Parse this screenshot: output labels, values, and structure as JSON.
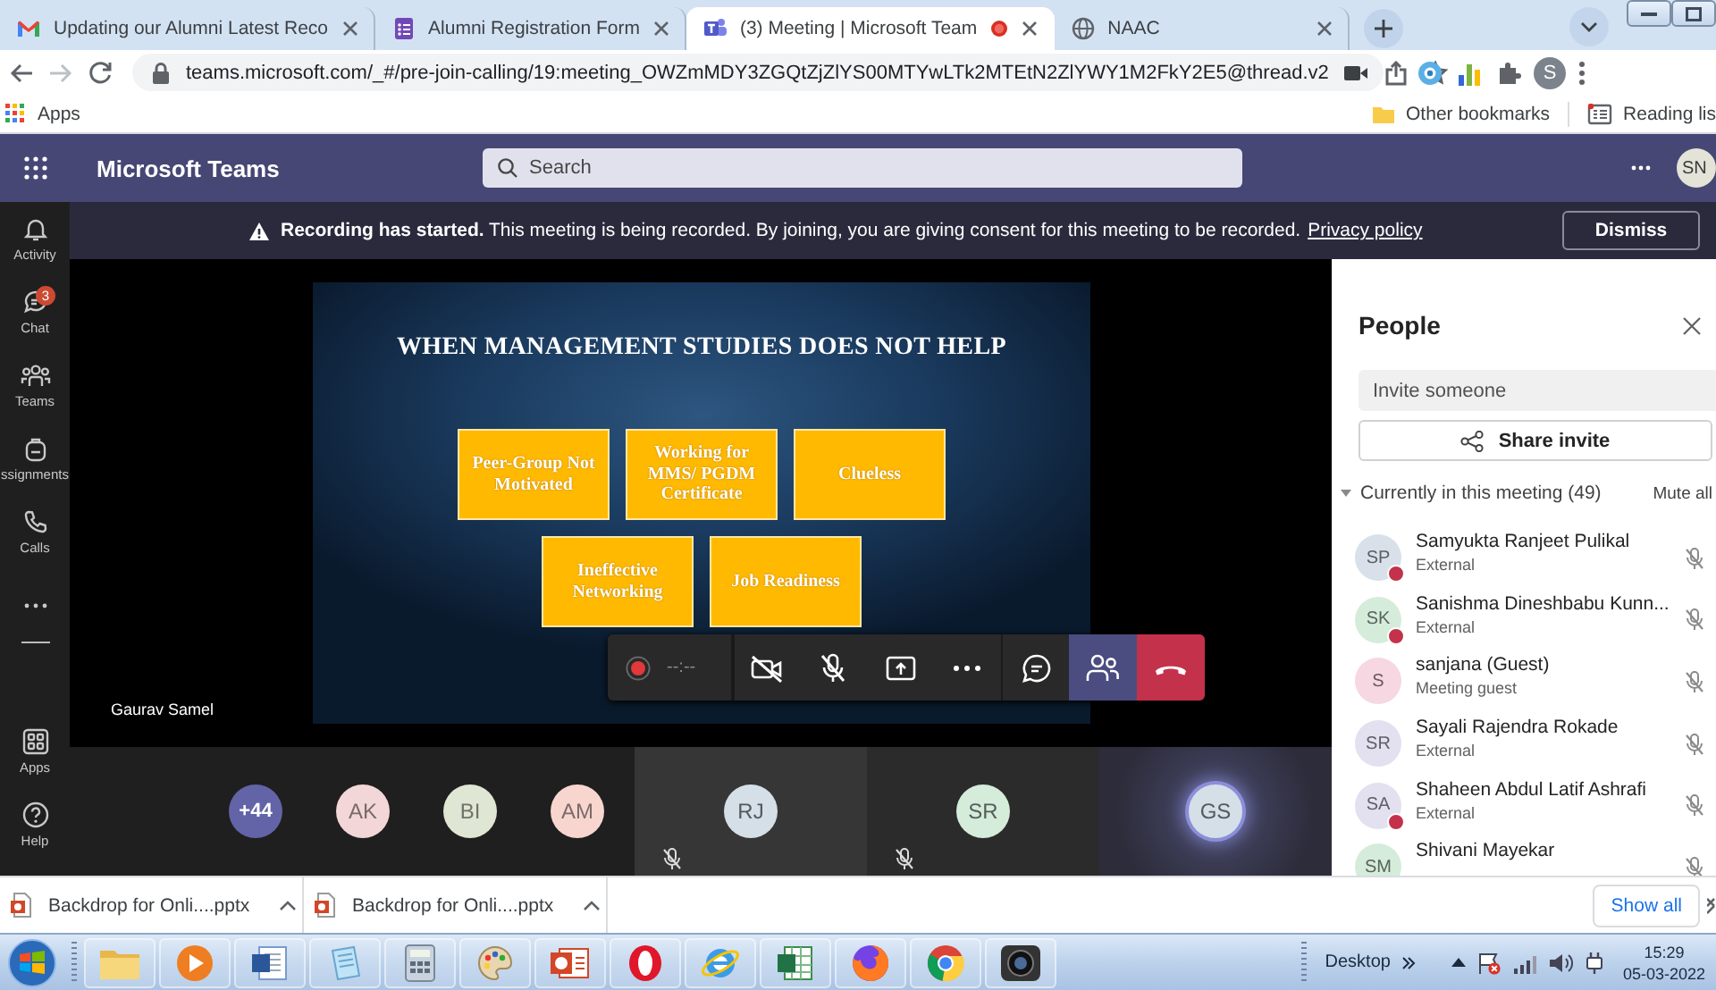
{
  "browser": {
    "tabs": [
      {
        "kind": "mail",
        "title": "Updating our Alumni Latest Reco",
        "selected": false,
        "recording": false
      },
      {
        "kind": "form",
        "title": "Alumni Registration Form",
        "selected": false,
        "recording": false
      },
      {
        "kind": "teams",
        "title": "(3) Meeting | Microsoft Team",
        "selected": true,
        "recording": true
      },
      {
        "kind": "globe",
        "title": "NAAC",
        "selected": false,
        "recording": false
      }
    ],
    "url": "teams.microsoft.com/_#/pre-join-calling/19:meeting_OWZmMDY3ZGQtZjZlYS00MTYwLTk2MTEtN2ZlYWY1M2FkY2E5@thread.v2",
    "profile": "S",
    "bookmarks": {
      "apps": "Apps",
      "other": "Other bookmarks",
      "reading_list": "Reading lis"
    }
  },
  "teams": {
    "title": "Microsoft Teams",
    "search": {
      "placeholder": "Search"
    },
    "avatar": "SN"
  },
  "banner": {
    "message": "**Recording has started.** This meeting is being recorded. By joining, you are giving consent for this meeting to be recorded.",
    "link": "Privacy policy",
    "button": "Dismiss"
  },
  "rail": {
    "items": [
      {
        "kind": "activity",
        "label": "Activity"
      },
      {
        "kind": "chat",
        "label": "Chat",
        "badge": "3"
      },
      {
        "kind": "teams",
        "label": "Teams"
      },
      {
        "kind": "assignments",
        "label": "ssignments"
      },
      {
        "kind": "calls",
        "label": "Calls"
      },
      {
        "kind": "more"
      }
    ],
    "bottom_items": [
      {
        "kind": "apps",
        "label": "Apps"
      },
      {
        "kind": "help",
        "label": "Help"
      }
    ]
  },
  "stage": {
    "slide": {
      "title": "WHEN MANAGEMENT STUDIES DOES NOT HELP",
      "rows": [
        [
          "Peer-Group Not Motivated",
          "Working for MMS/ PGDM Certificate",
          "Clueless"
        ],
        [
          "Ineffective Networking",
          "Job Readiness"
        ]
      ]
    },
    "presenter": "Gaurav Samel",
    "call_controls": {
      "timer": "--:--",
      "buttons": [
        {
          "kind": "camera",
          "selected": false
        },
        {
          "kind": "mic",
          "selected": false
        },
        {
          "kind": "share",
          "selected": false
        },
        {
          "kind": "more",
          "selected": false
        },
        {
          "kind": "chat",
          "selected": false
        },
        {
          "kind": "people",
          "selected": true
        },
        {
          "kind": "hangup",
          "selected": false
        }
      ]
    }
  },
  "gallery": {
    "overflow": "+44",
    "avatars": [
      {
        "initials": "AK",
        "color": "#f3d6d8"
      },
      {
        "initials": "BI",
        "color": "#dfe6d3"
      },
      {
        "initials": "AM",
        "color": "#f8d6cf"
      }
    ],
    "tiles": [
      {
        "initials": "RJ",
        "color": "#d5dfe8",
        "muted": true,
        "speaking": false
      },
      {
        "initials": "SR",
        "color": "#d5ecdb",
        "muted": true,
        "speaking": false
      },
      {
        "initials": "GS",
        "color": "#d5dfe8",
        "muted": false,
        "speaking": true
      }
    ]
  },
  "people": {
    "title": "People",
    "invite": {
      "placeholder": "Invite someone"
    },
    "share_button": "Share invite",
    "section": "Currently in this meeting (49)",
    "section_expanded": true,
    "mute_all": "Mute all",
    "participants": [
      {
        "initials": "SP",
        "color": "#d8e1ea",
        "name": "Samyukta Ranjeet Pulikal",
        "role": "External",
        "busy": true,
        "muted": true
      },
      {
        "initials": "SK",
        "color": "#d5ecdb",
        "name": "Sanishma Dineshbabu Kunn...",
        "role": "External",
        "busy": true,
        "muted": true
      },
      {
        "initials": "S",
        "color": "#f7d7e1",
        "name": "sanjana (Guest)",
        "role": "Meeting guest",
        "busy": false,
        "muted": true
      },
      {
        "initials": "SR",
        "color": "#e3e0f0",
        "name": "Sayali Rajendra Rokade",
        "role": "External",
        "busy": false,
        "muted": true
      },
      {
        "initials": "SA",
        "color": "#e3e0f0",
        "name": "Shaheen Abdul Latif Ashrafi",
        "role": "External",
        "busy": true,
        "muted": true
      },
      {
        "initials": "SM",
        "color": "#d5ecdb",
        "name": "Shivani Mayekar",
        "busy": false,
        "muted": true
      }
    ]
  },
  "downloads": {
    "items": [
      "Backdrop for Onli....pptx",
      "Backdrop for Onli....pptx"
    ],
    "button": "Show all"
  },
  "taskbar": {
    "apps": [
      {
        "kind": "folder"
      },
      {
        "kind": "media"
      },
      {
        "kind": "word"
      },
      {
        "kind": "notepad"
      },
      {
        "kind": "calculator"
      },
      {
        "kind": "paint"
      },
      {
        "kind": "slides"
      },
      {
        "kind": "opera"
      },
      {
        "kind": "ie"
      },
      {
        "kind": "excel"
      },
      {
        "kind": "firefox"
      },
      {
        "kind": "chrome"
      },
      {
        "kind": "camera"
      }
    ],
    "toolbar": "Desktop",
    "time": "15:29",
    "date": "05-03-2022"
  }
}
